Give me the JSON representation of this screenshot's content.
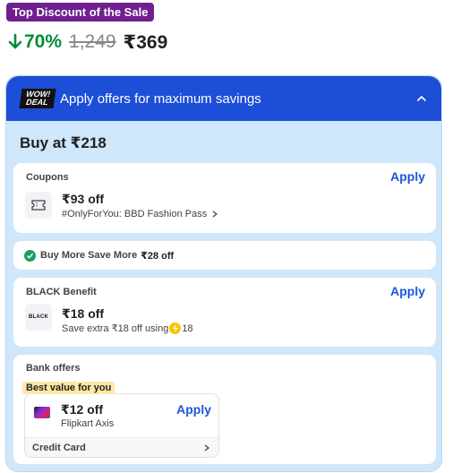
{
  "badge": {
    "label": "Top Discount of the Sale"
  },
  "pricing": {
    "discount": "70%",
    "mrp": "1,249",
    "price": "₹369"
  },
  "offers": {
    "logo_line1": "WOW!",
    "logo_line2": "DEAL",
    "header_title": "Apply offers for maximum savings",
    "buy_at": "Buy at ₹218",
    "coupons": {
      "label": "Coupons",
      "apply": "Apply",
      "amount": "₹93 off",
      "subtitle": "#OnlyForYou: BBD Fashion Pass"
    },
    "buy_more": {
      "label": "Buy More Save More",
      "amount": "₹28 off"
    },
    "black": {
      "label": "BLACK Benefit",
      "apply": "Apply",
      "logo": "BLACK",
      "amount": "₹18 off",
      "subtitle_prefix": "Save extra ₹18 off using",
      "subtitle_suffix": "18"
    },
    "bank": {
      "label": "Bank offers",
      "tag": "Best value for you",
      "amount": "₹12 off",
      "bank_name": "Flipkart Axis",
      "apply": "Apply",
      "footer": "Credit Card"
    }
  },
  "colors": {
    "badge": "#6f1f8e",
    "discount": "#008c3a",
    "header": "#1d4ed8",
    "panel": "#cfe7fb",
    "apply": "#1a56db"
  }
}
